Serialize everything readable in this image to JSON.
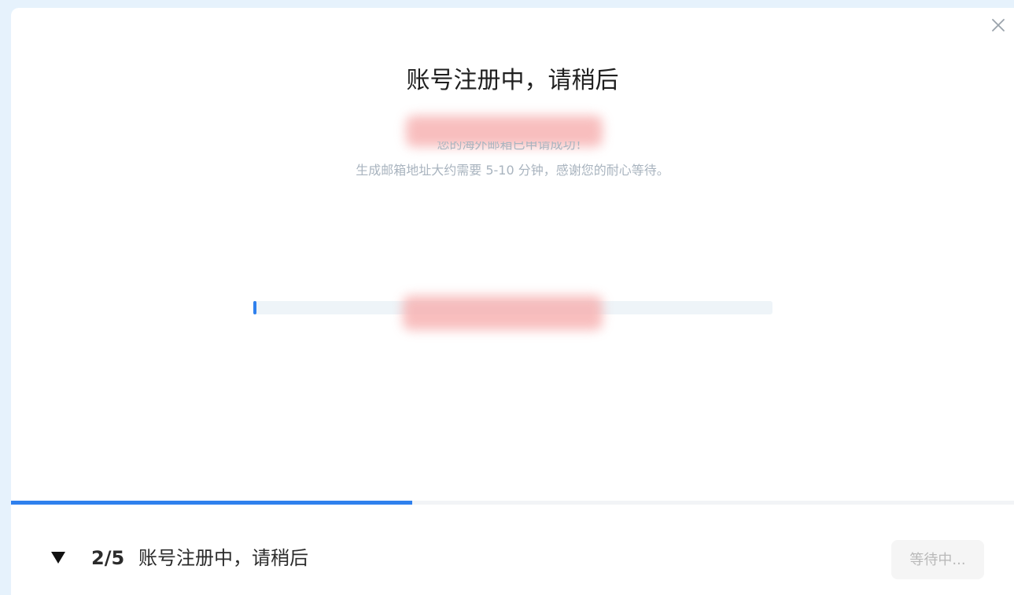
{
  "modal": {
    "title": "账号注册中，请稍后",
    "message_line1": "您的海外邮箱已申请成功！",
    "message_line2": "生成邮箱地址大约需要 5-10 分钟，感谢您的耐心等待。",
    "registration_progress": 0.005
  },
  "footer": {
    "step_current": 2,
    "step_total": 5,
    "step_count": "2/5",
    "step_label": "账号注册中，请稍后",
    "wait_button_label": "等待中..."
  },
  "icons": {
    "close": "close-icon",
    "toggle": "caret-down-icon"
  },
  "colors": {
    "accent": "#2f80ed",
    "title_text": "#1f1f1f",
    "muted_text": "#a9b4bf",
    "track": "#eef4f8",
    "disabled_button_bg": "#f5f5f5",
    "disabled_button_text": "#b9b9b9"
  }
}
